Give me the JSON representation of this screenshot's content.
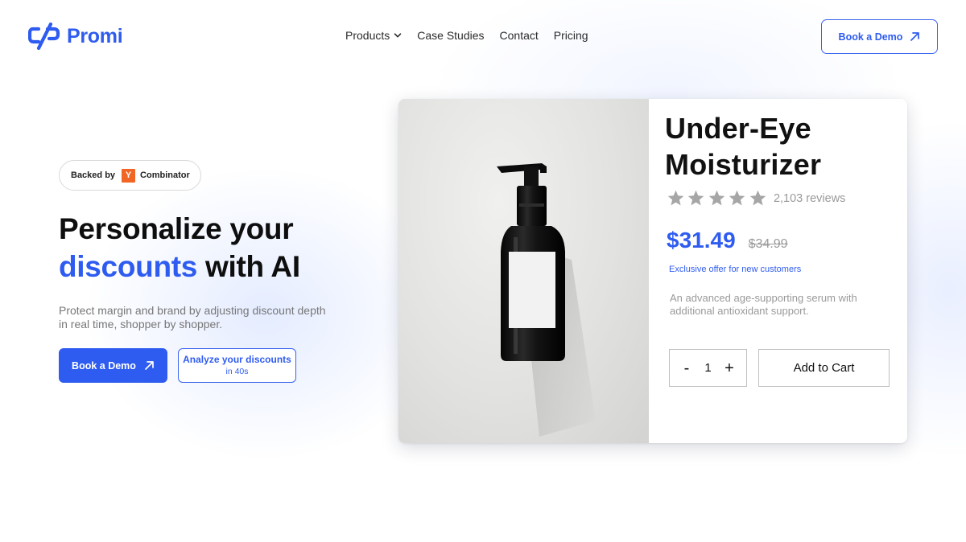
{
  "brand": {
    "name": "Promi",
    "color": "#2f5cf0"
  },
  "nav": {
    "items": [
      {
        "label": "Products",
        "has_dropdown": true
      },
      {
        "label": "Case Studies"
      },
      {
        "label": "Contact"
      },
      {
        "label": "Pricing"
      }
    ],
    "cta_label": "Book a Demo"
  },
  "hero": {
    "badge": {
      "prefix": "Backed by",
      "yc_letter": "Y",
      "suffix": "Combinator"
    },
    "headline": {
      "line1": "Personalize your",
      "accent": "discounts",
      "rest": " with AI"
    },
    "subtext": "Protect margin and brand by adjusting discount depth in real time, shopper by shopper.",
    "primary_button": "Book a Demo",
    "secondary_button": {
      "line1": "Analyze your discounts",
      "line2": "in 40s"
    }
  },
  "product": {
    "title": "Under-Eye Moisturizer",
    "rating": 5,
    "reviews": "2,103 reviews",
    "price": "$31.49",
    "old_price": "$34.99",
    "offer": "Exclusive offer for new customers",
    "description": "An advanced age-supporting serum with additional antioxidant support.",
    "quantity": "1",
    "qty_minus": "-",
    "qty_plus": "+",
    "add_to_cart": "Add to Cart"
  },
  "colors": {
    "accent": "#2f5cf0",
    "star": "#a6a6a6",
    "yc_orange": "#f26625"
  },
  "icons": {
    "logo": "promi-logo-icon",
    "dropdown": "chevron-down-icon",
    "cta_arrow": "arrow-up-right-icon",
    "rating": "star-icon",
    "product_image": "pump-bottle-image"
  }
}
